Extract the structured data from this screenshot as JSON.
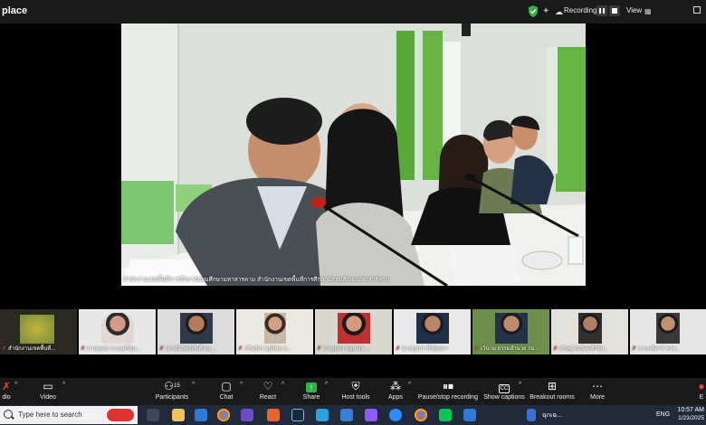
{
  "window": {
    "title": "place",
    "recording_label": "Recording...",
    "view_label": "View",
    "grid_icon": "grid-icon"
  },
  "main_video": {
    "name": "สำนักงานเขตพื้นที่การศึกษามัธยมศึกษามหาสารคาม สำนักงานเขตพื้นที่การศึกษามัธยมศึกษามหาสารคาม"
  },
  "gallery": [
    {
      "name": "สำนักงานเขตพื้นที่..."
    },
    {
      "name": "นายสุเมธ นาเมศรีสุน..."
    },
    {
      "name": "ปกรณ์ อิทธิศักดิ์ ผอ..."
    },
    {
      "name": "กริสศักร อุปไพ่ม ผ..."
    },
    {
      "name": "กาญจนา กตุลาณ ..."
    },
    {
      "name": "นายดุสกร ทั้งบุ๊เสนา"
    },
    {
      "name": "เว้นาม ธรรมอำนวย รอ..."
    },
    {
      "name": "ศริษฐ์ สมจิตตสิริบัก..."
    },
    {
      "name": "นายกษิดาร์ ชาย..."
    }
  ],
  "toolbar": {
    "audio": "dio",
    "video": "Video",
    "participants": "Participants",
    "participants_count": "15",
    "chat": "Chat",
    "react": "React",
    "share": "Share",
    "host_tools": "Host tools",
    "apps": "Apps",
    "pause_recording": "Pause/stop recording",
    "captions": "Show captions",
    "breakout": "Breakout rooms",
    "more": "More",
    "end": "E"
  },
  "taskbar": {
    "search_placeholder": "Type here to search",
    "weather_text": "ฉุกเฉ...",
    "language": "ENG",
    "time": "10:57 AM",
    "date": "1/23/2025"
  },
  "colors": {
    "toolbar_bg": "#1a1a1a",
    "taskbar_bg": "#202a3a",
    "shield_green": "#2fb34a",
    "mic_red": "#e0463a",
    "share_green": "#2fb34a"
  }
}
